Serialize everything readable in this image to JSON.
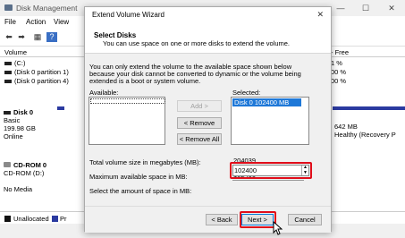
{
  "bg_window": {
    "title": "Disk Management",
    "menu": [
      "File",
      "Action",
      "View"
    ],
    "controls": {
      "minimize": "—",
      "maximize": "☐",
      "close": "✕"
    }
  },
  "volume_list": {
    "col_volume": "Volume",
    "col_free": "- Free",
    "rows": [
      {
        "volume": "(C:)",
        "free": "1 %"
      },
      {
        "volume": "(Disk 0 partition 1)",
        "free": "00 %"
      },
      {
        "volume": "(Disk 0 partition 4)",
        "free": "00 %"
      }
    ]
  },
  "disks": {
    "disk0": {
      "name": "Disk 0",
      "type": "Basic",
      "size": "199.98 GB",
      "status": "Online"
    },
    "disk0_partition": {
      "size": "642 MB",
      "status": "Healthy (Recovery P"
    },
    "cdrom0": {
      "name": "CD-ROM 0",
      "drive": "CD-ROM (D:)",
      "media": "No Media"
    }
  },
  "legend": {
    "unallocated": "Unallocated",
    "primary": "Pr"
  },
  "dialog": {
    "title": "Extend Volume Wizard",
    "close": "✕",
    "heading": "Select Disks",
    "subheading": "You can use space on one or more disks to extend the volume.",
    "description": "You can only extend the volume to the available space shown below because your disk cannot be converted to dynamic or the volume being extended is a boot or system volume.",
    "available_label": "Available:",
    "selected_label": "Selected:",
    "selected_item": "Disk 0     102400 MB",
    "add_button": "Add >",
    "remove_button": "< Remove",
    "remove_all_button": "< Remove All",
    "total_label": "Total volume size in megabytes (MB):",
    "total_value": "204039",
    "max_label": "Maximum available space in MB:",
    "max_value": "102400",
    "select_label": "Select the amount of space in MB:",
    "select_value": "102400",
    "back_button": "< Back",
    "next_button": "Next >",
    "cancel_button": "Cancel"
  },
  "colors": {
    "accent": "#1e78d8",
    "highlight": "#e00d1a",
    "disk_bar": "#2b3aa0"
  }
}
